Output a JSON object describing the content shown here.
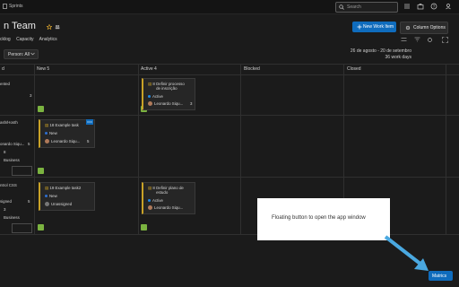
{
  "topbar": {
    "breadcrumb": "Sprints",
    "search_placeholder": "Search"
  },
  "header": {
    "team_title": "n Team",
    "tabs": [
      "cklog",
      "Capacity",
      "Analytics"
    ],
    "new_work_item": "New Work Item",
    "column_options": "Column Options",
    "person_filter": "Person: All",
    "date_range": "26 de agosto - 20 de setembro",
    "work_days": "36 work days"
  },
  "columns": [
    {
      "label": "d",
      "count": ""
    },
    {
      "label": "New",
      "count": "5"
    },
    {
      "label": "Active",
      "count": "4"
    },
    {
      "label": "Blocked",
      "count": ""
    },
    {
      "label": "Closed",
      "count": ""
    }
  ],
  "rows": [
    {
      "left": {
        "title": "ented",
        "count": "3"
      },
      "cards": [
        {
          "id": "8",
          "title": "Definir processo de inscrição",
          "state": "Active",
          "assignee": "Leonardo Siqu...",
          "num": "3",
          "column": "active"
        }
      ]
    },
    {
      "left": {
        "title": "ash/Hosth",
        "owner": "onardo Siqu...",
        "count": "5",
        "small1": "8",
        "small2": "Business"
      },
      "cards": [
        {
          "id": "18",
          "title": "Example task",
          "state": "New",
          "assignee": "Leonardo Siqu...",
          "num": "5",
          "column": "new"
        }
      ]
    },
    {
      "left": {
        "title": "ntrol CSS",
        "owner": "signed",
        "count": "5",
        "small1": "3",
        "small2": "Business"
      },
      "cards": [
        {
          "id": "19",
          "title": "Example task2",
          "state": "New",
          "assignee": "Unassigned",
          "num": "",
          "column": "new"
        },
        {
          "id": "8",
          "title": "Definir plano de estudo",
          "state": "Active",
          "assignee": "Leonardo Siqu...",
          "num": "",
          "column": "active"
        }
      ]
    }
  ],
  "callout_text": "Floating button to open the app window",
  "matrix_button": "Matrics",
  "colors": {
    "accent": "#0f6cbd",
    "card_border": "#c9a227",
    "add_green": "#7bb340",
    "new_dot": "#1e88e5",
    "active_dot": "#1e88e5",
    "arrow": "#4aa8e0"
  }
}
